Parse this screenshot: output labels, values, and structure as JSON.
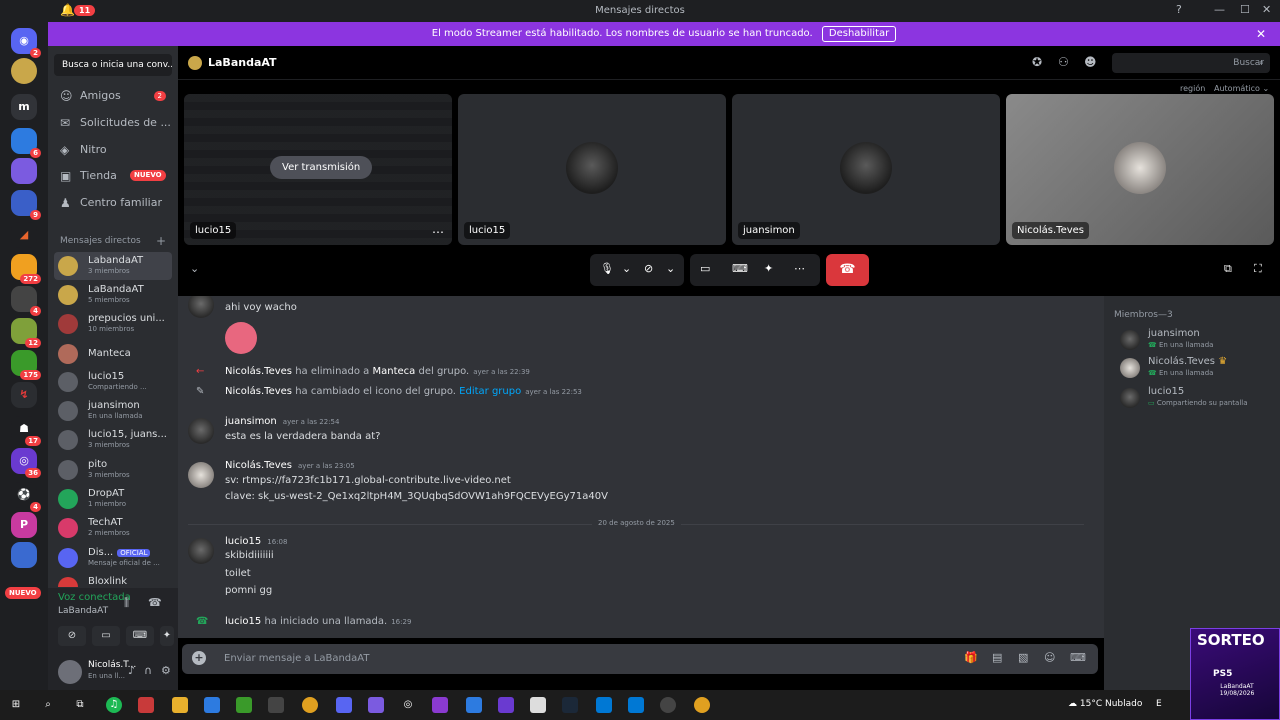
{
  "titlebar": {
    "badge": "11",
    "title": "Mensajes directos"
  },
  "banner": {
    "text": "El modo Streamer está habilitado. Los nombres de usuario se han truncado.",
    "button": "Deshabilitar"
  },
  "servers": {
    "badges": [
      "2",
      "6",
      "9",
      "272",
      "4",
      "12",
      "175",
      "17",
      "36",
      "4"
    ],
    "home_letter": "m",
    "nuevo": "NUEVO"
  },
  "sidebar": {
    "search": "Busca o inicia una conv...",
    "nav": [
      {
        "label": "Amigos",
        "badge": "2"
      },
      {
        "label": "Solicitudes de ..."
      },
      {
        "label": "Nitro"
      },
      {
        "label": "Tienda",
        "tag": "NUEVO"
      },
      {
        "label": "Centro familiar"
      }
    ],
    "dm_header": "Mensajes directos",
    "dms": [
      {
        "name": "LabandaAT",
        "sub": "3 miembros"
      },
      {
        "name": "LaBandaAT",
        "sub": "5 miembros"
      },
      {
        "name": "prepucios uni...",
        "sub": "10 miembros"
      },
      {
        "name": "Manteca",
        "sub": ""
      },
      {
        "name": "lucio15",
        "sub": "Compartiendo ..."
      },
      {
        "name": "juansimon",
        "sub": "En una llamada"
      },
      {
        "name": "lucio15, juans...",
        "sub": "3 miembros"
      },
      {
        "name": "pito",
        "sub": "3 miembros"
      },
      {
        "name": "DropAT",
        "sub": "1 miembro"
      },
      {
        "name": "TechAT",
        "sub": "2 miembros"
      },
      {
        "name": "Dis...",
        "sub": "Mensaje oficial de ...",
        "tag": "OFICIAL"
      },
      {
        "name": "Bloxlink",
        "sub": ""
      }
    ],
    "voice": {
      "status": "Voz conectada",
      "channel": "LaBandaAT",
      "user": "Nicolás.T...",
      "user_status": "En una ll..."
    }
  },
  "channel": {
    "name": "LaBandaAT",
    "search": "Buscar",
    "region": "región",
    "region_value": "Automático"
  },
  "tiles": [
    {
      "label": "lucio15",
      "overlay": "Ver transmisión"
    },
    {
      "label": "lucio15"
    },
    {
      "label": "juansimon"
    },
    {
      "label": "Nicolás.Teves"
    }
  ],
  "messages": {
    "m1": {
      "text": "ahi voy wacho"
    },
    "s1": {
      "user": "Nicolás.Teves",
      "action": "ha eliminado a",
      "target": "Manteca",
      "rest": "del grupo.",
      "time": "ayer a las 22:39"
    },
    "s2": {
      "user": "Nicolás.Teves",
      "action": "ha cambiado el icono del grupo.",
      "link": "Editar grupo",
      "time": "ayer a las 22:53"
    },
    "m2": {
      "user": "juansimon",
      "time": "ayer a las 22:54",
      "text": "esta es la verdadera banda at?"
    },
    "m3": {
      "user": "Nicolás.Teves",
      "time": "ayer a las 23:05",
      "line1": "sv: rtmps://fa723fc1b171.global-contribute.live-video.net",
      "line2": "clave: sk_us-west-2_Qe1xq2ltpH4M_3QUqbqSdOVW1ah9FQCEVyEGy71a40V"
    },
    "divider": "20 de agosto de 2025",
    "m4": {
      "user": "lucio15",
      "time": "16:08",
      "l1": "skibidiiiiiii",
      "l2": "toilet",
      "l3": "pomni gg"
    },
    "s3": {
      "user": "lucio15",
      "action": "ha iniciado una llamada.",
      "time": "16:29"
    }
  },
  "composer": {
    "placeholder": "Enviar mensaje a LaBandaAT"
  },
  "members": {
    "header": "Miembros—3",
    "list": [
      {
        "name": "juansimon",
        "status": "En una llamada"
      },
      {
        "name": "Nicolás.Teves",
        "status": "En una llamada"
      },
      {
        "name": "lucio15",
        "status": "Compartiendo su pantalla"
      }
    ]
  },
  "taskbar": {
    "weather": "15°C  Nublado",
    "lang": "E"
  },
  "sorteo": {
    "title": "SORTEO",
    "product": "PS5",
    "line1": "LaBandaAT",
    "line2": "19/08/2026"
  }
}
